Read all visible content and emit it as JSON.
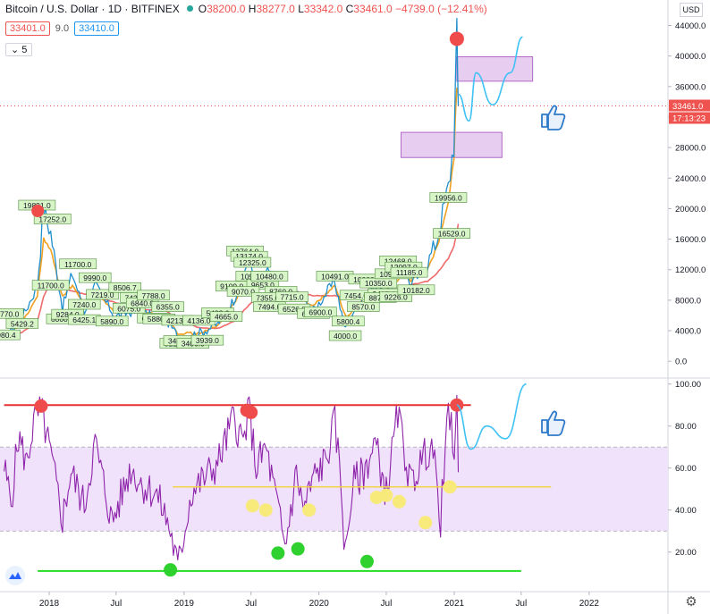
{
  "header": {
    "symbol": "Bitcoin / U.S. Dollar · 1D · BITFINEX",
    "o_label": "O",
    "o_value": "38200.0",
    "h_label": "H",
    "h_value": "38277.0",
    "l_label": "L",
    "l_value": "33342.0",
    "c_label": "C",
    "c_value": "33461.0",
    "change": "−4739.0 (−12.41%)",
    "ma1": "33401.0",
    "ma_len": "9.0",
    "ma2": "33410.0",
    "collapse_count": "5",
    "currency": "USD"
  },
  "colors": {
    "price": "#1f8fce",
    "ma_fast": "#f0a020",
    "ma_slow": "#ef6a6a",
    "rsi": "#8e24aa",
    "rsi_band": "#f0e2fb",
    "label_bg": "#d8f5c8",
    "zone_fill": "#e7cdf0",
    "zone_stroke": "#b069c6",
    "red_line": "#e82f2f",
    "green_line": "#22dd22",
    "yellow_line": "#f0d23a",
    "projection": "#3ec1f5"
  },
  "chart_data": [
    {
      "type": "line",
      "title": "",
      "ylim": [
        -1500,
        45000
      ],
      "yticks": [
        0,
        4000,
        8000,
        12000,
        16000,
        20000,
        24000,
        28000,
        32000,
        36000,
        40000,
        44000
      ],
      "ytick_labels": [
        "0.0",
        "4000.0",
        "8000.0",
        "12000.0",
        "16000.0",
        "20000.0",
        "24000.0",
        "28000.0",
        "32000.0",
        "36000.0",
        "40000.0",
        "44000.0"
      ],
      "last_price": "33461.0",
      "countdown": "17:13:23",
      "x_dates": [
        "2017-09-01",
        "2017-10-20",
        "2017-11-30",
        "2017-12-17",
        "2018-01-05",
        "2018-02-06",
        "2018-03-05",
        "2018-04-06",
        "2018-05-05",
        "2018-06-29",
        "2018-08-10",
        "2018-09-10",
        "2018-11-14",
        "2018-12-15",
        "2019-02-08",
        "2019-04-02",
        "2019-05-15",
        "2019-06-26",
        "2019-07-17",
        "2019-08-10",
        "2019-09-24",
        "2019-10-26",
        "2019-12-17",
        "2020-02-13",
        "2020-03-12",
        "2020-03-16",
        "2020-04-30",
        "2020-05-20",
        "2020-06-27",
        "2020-07-27",
        "2020-08-17",
        "2020-09-05",
        "2020-10-21",
        "2020-11-15",
        "2020-12-16",
        "2020-12-31",
        "2021-01-08",
        "2021-01-12"
      ],
      "series": [
        {
          "values": [
            3000,
            5700,
            9900,
            19891,
            16900,
            7000,
            11500,
            6600,
            9900,
            5850,
            6500,
            6250,
            5500,
            3216,
            3600,
            4900,
            8000,
            13764,
            9400,
            11900,
            8000,
            9300,
            6600,
            10480,
            4000,
            5000,
            8800,
            9500,
            9100,
            11000,
            12100,
            10000,
            12900,
            15900,
            22800,
            28900,
            41900,
            33461
          ]
        },
        {
          "values": [
            3000,
            5000,
            8500,
            16000,
            14500,
            8500,
            10000,
            7300,
            9000,
            6500,
            6600,
            6400,
            6000,
            3700,
            3600,
            4600,
            7500,
            11500,
            10000,
            11000,
            8900,
            8800,
            7300,
            9900,
            6000,
            5700,
            8000,
            9200,
            9200,
            10300,
            11600,
            10500,
            12100,
            15000,
            20500,
            27000,
            36000,
            35500
          ]
        },
        {
          "values": [
            3000,
            3800,
            5200,
            8500,
            10500,
            9600,
            9200,
            8800,
            8500,
            7700,
            7100,
            6800,
            6600,
            5600,
            4400,
            4300,
            5200,
            7400,
            8400,
            9000,
            9400,
            9200,
            8600,
            8600,
            8300,
            8200,
            8200,
            8400,
            8600,
            9200,
            9700,
            10000,
            10500,
            11500,
            13500,
            15000,
            17000,
            18000
          ]
        }
      ],
      "price_labels": [
        {
          "date": "2017-09-01",
          "value": 3400,
          "text": "2980.4"
        },
        {
          "date": "2017-09-10",
          "value": 6200,
          "text": "4770.0"
        },
        {
          "date": "2017-10-20",
          "value": 4900,
          "text": "5429.2"
        },
        {
          "date": "2017-11-29",
          "value": 20400,
          "text": "19891.0"
        },
        {
          "date": "2018-01-10",
          "value": 18600,
          "text": "17252.0"
        },
        {
          "date": "2018-01-05",
          "value": 9900,
          "text": "11700.0"
        },
        {
          "date": "2018-02-06",
          "value": 5500,
          "text": "6000.0"
        },
        {
          "date": "2018-02-20",
          "value": 6100,
          "text": "9284.0"
        },
        {
          "date": "2018-03-20",
          "value": 12700,
          "text": "11700.0"
        },
        {
          "date": "2018-04-06",
          "value": 7400,
          "text": "7240.0"
        },
        {
          "date": "2018-04-06",
          "value": 5400,
          "text": "6425.1"
        },
        {
          "date": "2018-05-05",
          "value": 10900,
          "text": "9990.0"
        },
        {
          "date": "2018-05-25",
          "value": 8700,
          "text": "7219.0"
        },
        {
          "date": "2018-06-20",
          "value": 5200,
          "text": "5890.0"
        },
        {
          "date": "2018-07-25",
          "value": 9600,
          "text": "8506.7"
        },
        {
          "date": "2018-08-05",
          "value": 6900,
          "text": "6075.0"
        },
        {
          "date": "2018-08-25",
          "value": 8300,
          "text": "7434.0"
        },
        {
          "date": "2018-09-10",
          "value": 7600,
          "text": "6840.0"
        },
        {
          "date": "2018-10-10",
          "value": 8600,
          "text": "7788.0"
        },
        {
          "date": "2018-10-10",
          "value": 5600,
          "text": "6240.0"
        },
        {
          "date": "2018-11-18",
          "value": 7100,
          "text": "6355.0"
        },
        {
          "date": "2018-10-25",
          "value": 5500,
          "text": "5886.6"
        },
        {
          "date": "2018-12-15",
          "value": 5300,
          "text": "4213.1"
        },
        {
          "date": "2018-12-10",
          "value": 2300,
          "text": "3216.0"
        },
        {
          "date": "2018-12-20",
          "value": 2650,
          "text": "3480.0"
        },
        {
          "date": "2019-01-25",
          "value": 2300,
          "text": "3406.0"
        },
        {
          "date": "2019-02-10",
          "value": 5300,
          "text": "4136.0"
        },
        {
          "date": "2019-03-05",
          "value": 2700,
          "text": "3939.0"
        },
        {
          "date": "2019-04-02",
          "value": 6300,
          "text": "5488.0"
        },
        {
          "date": "2019-04-25",
          "value": 5800,
          "text": "4665.0"
        },
        {
          "date": "2019-05-10",
          "value": 9800,
          "text": "9109.0"
        },
        {
          "date": "2019-06-15",
          "value": 14400,
          "text": "13764.0"
        },
        {
          "date": "2019-06-26",
          "value": 13700,
          "text": "13174.0"
        },
        {
          "date": "2019-07-05",
          "value": 12900,
          "text": "12325.0"
        },
        {
          "date": "2019-07-10",
          "value": 11100,
          "text": "10900.0"
        },
        {
          "date": "2019-08-02",
          "value": 10000,
          "text": "9653.0"
        },
        {
          "date": "2019-08-20",
          "value": 11100,
          "text": "10480.0"
        },
        {
          "date": "2019-09-20",
          "value": 9100,
          "text": "8760.0"
        },
        {
          "date": "2019-06-10",
          "value": 9100,
          "text": "9070.0"
        },
        {
          "date": "2019-08-15",
          "value": 8300,
          "text": "7355.0"
        },
        {
          "date": "2019-08-20",
          "value": 7100,
          "text": "7494.0"
        },
        {
          "date": "2019-10-20",
          "value": 8400,
          "text": "7715.0"
        },
        {
          "date": "2019-10-26",
          "value": 6800,
          "text": "6526.0"
        },
        {
          "date": "2019-12-17",
          "value": 6200,
          "text": "6500.0"
        },
        {
          "date": "2020-01-05",
          "value": 6400,
          "text": "6900.0"
        },
        {
          "date": "2020-02-13",
          "value": 11100,
          "text": "10491.0"
        },
        {
          "date": "2020-03-12",
          "value": 3300,
          "text": "4000.0"
        },
        {
          "date": "2020-03-20",
          "value": 5200,
          "text": "5800.4"
        },
        {
          "date": "2020-04-10",
          "value": 8600,
          "text": "7454.0"
        },
        {
          "date": "2020-04-30",
          "value": 7100,
          "text": "8570.0"
        },
        {
          "date": "2020-05-10",
          "value": 10700,
          "text": "10000.0"
        },
        {
          "date": "2020-06-10",
          "value": 10200,
          "text": "10350.0"
        },
        {
          "date": "2020-06-25",
          "value": 8800,
          "text": "9497.0"
        },
        {
          "date": "2020-07-20",
          "value": 11400,
          "text": "10988.0"
        },
        {
          "date": "2020-06-15",
          "value": 8300,
          "text": "8871.0"
        },
        {
          "date": "2020-07-27",
          "value": 8400,
          "text": "9226.0"
        },
        {
          "date": "2020-08-02",
          "value": 13100,
          "text": "12468.0"
        },
        {
          "date": "2020-08-17",
          "value": 12300,
          "text": "12097.0"
        },
        {
          "date": "2020-09-01",
          "value": 11600,
          "text": "11185.0"
        },
        {
          "date": "2020-09-20",
          "value": 9300,
          "text": "10182.0"
        },
        {
          "date": "2020-12-16",
          "value": 21400,
          "text": "19956.0"
        },
        {
          "date": "2020-12-25",
          "value": 16700,
          "text": "16529.0"
        }
      ],
      "peak_marker": {
        "date": "2021-01-08",
        "value": 41900
      },
      "early_marker": {
        "date": "2017-12-01",
        "value": 19700
      },
      "zones": [
        {
          "date_from": "2021-01-08",
          "date_to": "2021-08-01",
          "y_from": 36700,
          "y_to": 39900
        },
        {
          "date_from": "2020-08-10",
          "date_to": "2021-05-10",
          "y_from": 26700,
          "y_to": 30000
        }
      ],
      "projection": [
        {
          "date": "2021-01-12",
          "value": 35000
        },
        {
          "date": "2021-02-10",
          "value": 31500
        },
        {
          "date": "2021-03-01",
          "value": 37800
        },
        {
          "date": "2021-04-15",
          "value": 33600
        },
        {
          "date": "2021-06-01",
          "value": 37800
        },
        {
          "date": "2021-07-05",
          "value": 42500
        }
      ]
    },
    {
      "type": "line",
      "title": "",
      "ylim": [
        2,
        102
      ],
      "yticks": [
        20,
        40,
        60,
        80,
        100
      ],
      "ytick_labels": [
        "20.00",
        "40.00",
        "60.00",
        "80.00",
        "100.00"
      ],
      "band": [
        30,
        70
      ],
      "x_dates": [
        "2017-09-01",
        "2017-09-20",
        "2017-10-10",
        "2017-11-01",
        "2017-11-20",
        "2017-12-10",
        "2018-01-05",
        "2018-02-06",
        "2018-03-01",
        "2018-04-06",
        "2018-05-05",
        "2018-06-20",
        "2018-08-10",
        "2018-09-10",
        "2018-10-15",
        "2018-11-01",
        "2018-11-25",
        "2018-12-15",
        "2019-01-20",
        "2019-03-01",
        "2019-04-02",
        "2019-05-15",
        "2019-06-10",
        "2019-06-26",
        "2019-07-15",
        "2019-08-10",
        "2019-09-10",
        "2019-10-01",
        "2019-11-01",
        "2019-11-20",
        "2019-12-17",
        "2020-01-20",
        "2020-02-13",
        "2020-03-01",
        "2020-03-12",
        "2020-04-01",
        "2020-05-01",
        "2020-06-01",
        "2020-07-01",
        "2020-08-01",
        "2020-09-05",
        "2020-10-01",
        "2020-11-01",
        "2020-11-25",
        "2020-12-16",
        "2021-01-01",
        "2021-01-08",
        "2021-01-12"
      ],
      "series": [
        {
          "values": [
            60,
            44,
            75,
            62,
            82,
            88,
            66,
            36,
            58,
            42,
            72,
            34,
            60,
            52,
            48,
            42,
            30,
            12,
            48,
            56,
            62,
            84,
            72,
            88,
            60,
            70,
            42,
            22,
            58,
            40,
            55,
            64,
            82,
            52,
            18,
            52,
            58,
            72,
            48,
            86,
            52,
            62,
            72,
            36,
            86,
            70,
            90,
            58
          ]
        }
      ],
      "red_line": {
        "value": 90,
        "date_from": "2017-09-01",
        "date_to": "2021-02-15"
      },
      "yellow_line": {
        "value": 51,
        "date_from": "2018-12-01",
        "date_to": "2021-09-20"
      },
      "green_line": {
        "value": 11,
        "date_from": "2017-12-01",
        "date_to": "2021-07-01"
      },
      "red_markers": [
        {
          "date": "2017-12-10",
          "value": 89.5
        },
        {
          "date": "2019-06-20",
          "value": 87.5
        },
        {
          "date": "2019-07-01",
          "value": 86.5
        },
        {
          "date": "2021-01-08",
          "value": 90
        }
      ],
      "green_markers": [
        {
          "date": "2018-11-25",
          "value": 11.5
        },
        {
          "date": "2019-09-12",
          "value": 19.5
        },
        {
          "date": "2019-11-05",
          "value": 21.5
        },
        {
          "date": "2020-05-10",
          "value": 15.5
        }
      ],
      "yellow_markers": [
        {
          "date": "2019-07-05",
          "value": 42
        },
        {
          "date": "2019-08-10",
          "value": 40
        },
        {
          "date": "2019-12-05",
          "value": 40
        },
        {
          "date": "2020-06-05",
          "value": 46
        },
        {
          "date": "2020-07-01",
          "value": 47
        },
        {
          "date": "2020-08-05",
          "value": 44
        },
        {
          "date": "2020-10-15",
          "value": 34
        },
        {
          "date": "2020-12-20",
          "value": 51
        }
      ],
      "projection": [
        {
          "date": "2021-01-08",
          "value": 90
        },
        {
          "date": "2021-02-15",
          "value": 69
        },
        {
          "date": "2021-03-30",
          "value": 80
        },
        {
          "date": "2021-05-20",
          "value": 74
        },
        {
          "date": "2021-07-15",
          "value": 100
        }
      ]
    }
  ],
  "x_axis": {
    "ticks": [
      {
        "date": "2018-01-01",
        "label": "2018"
      },
      {
        "date": "2018-07-01",
        "label": "Jul"
      },
      {
        "date": "2019-01-01",
        "label": "2019"
      },
      {
        "date": "2019-07-01",
        "label": "Jul"
      },
      {
        "date": "2020-01-01",
        "label": "2020"
      },
      {
        "date": "2020-07-01",
        "label": "Jul"
      },
      {
        "date": "2021-01-01",
        "label": "2021"
      },
      {
        "date": "2021-07-01",
        "label": "Jul"
      },
      {
        "date": "2022-01-01",
        "label": "2022"
      }
    ]
  },
  "icons": {
    "thumbs_up": "thumbs-up-icon",
    "settings": "gear-icon",
    "logo": "tradingview-logo-icon"
  }
}
